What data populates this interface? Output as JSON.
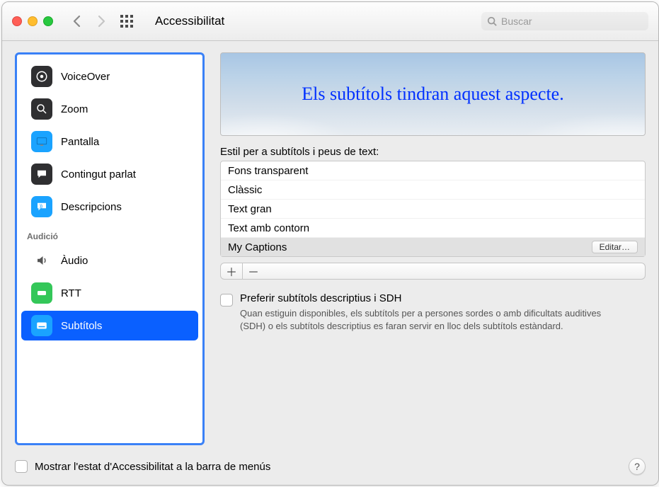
{
  "window": {
    "title": "Accessibilitat",
    "search_placeholder": "Buscar"
  },
  "sidebar": {
    "items_top": [
      {
        "label": "VoiceOver",
        "icon": "voiceover",
        "bg": "#2f2f31"
      },
      {
        "label": "Zoom",
        "icon": "zoom",
        "bg": "#2f2f31"
      },
      {
        "label": "Pantalla",
        "icon": "display",
        "bg": "#1aa3ff"
      },
      {
        "label": "Contingut parlat",
        "icon": "speech",
        "bg": "#2f2f31"
      },
      {
        "label": "Descripcions",
        "icon": "desc",
        "bg": "#1aa3ff"
      }
    ],
    "section_header": "Audició",
    "items_audio": [
      {
        "label": "Àudio",
        "icon": "audio",
        "bg": "transparent"
      },
      {
        "label": "RTT",
        "icon": "rtt",
        "bg": "#34c759"
      },
      {
        "label": "Subtítols",
        "icon": "captions",
        "bg": "#1aa3ff",
        "selected": true
      }
    ]
  },
  "pane": {
    "preview_text": "Els subtítols tindran aquest aspecte.",
    "styles_label": "Estil per a subtítols i peus de text:",
    "style_rows": [
      {
        "label": "Fons transparent"
      },
      {
        "label": "Clàssic"
      },
      {
        "label": "Text gran"
      },
      {
        "label": "Text amb contorn"
      },
      {
        "label": "My Captions",
        "selected": true,
        "edit": "Editar…"
      }
    ],
    "plus": "＋",
    "minus": "－",
    "pref_sdh_label": "Preferir subtítols descriptius i SDH",
    "pref_sdh_desc": "Quan estiguin disponibles, els subtítols per a persones sordes o amb dificultats auditives (SDH) o els subtítols descriptius es faran servir en lloc dels subtítols estàndard."
  },
  "footer": {
    "show_in_menubar": "Mostrar l'estat d'Accessibilitat a la barra de menús",
    "help": "?"
  }
}
